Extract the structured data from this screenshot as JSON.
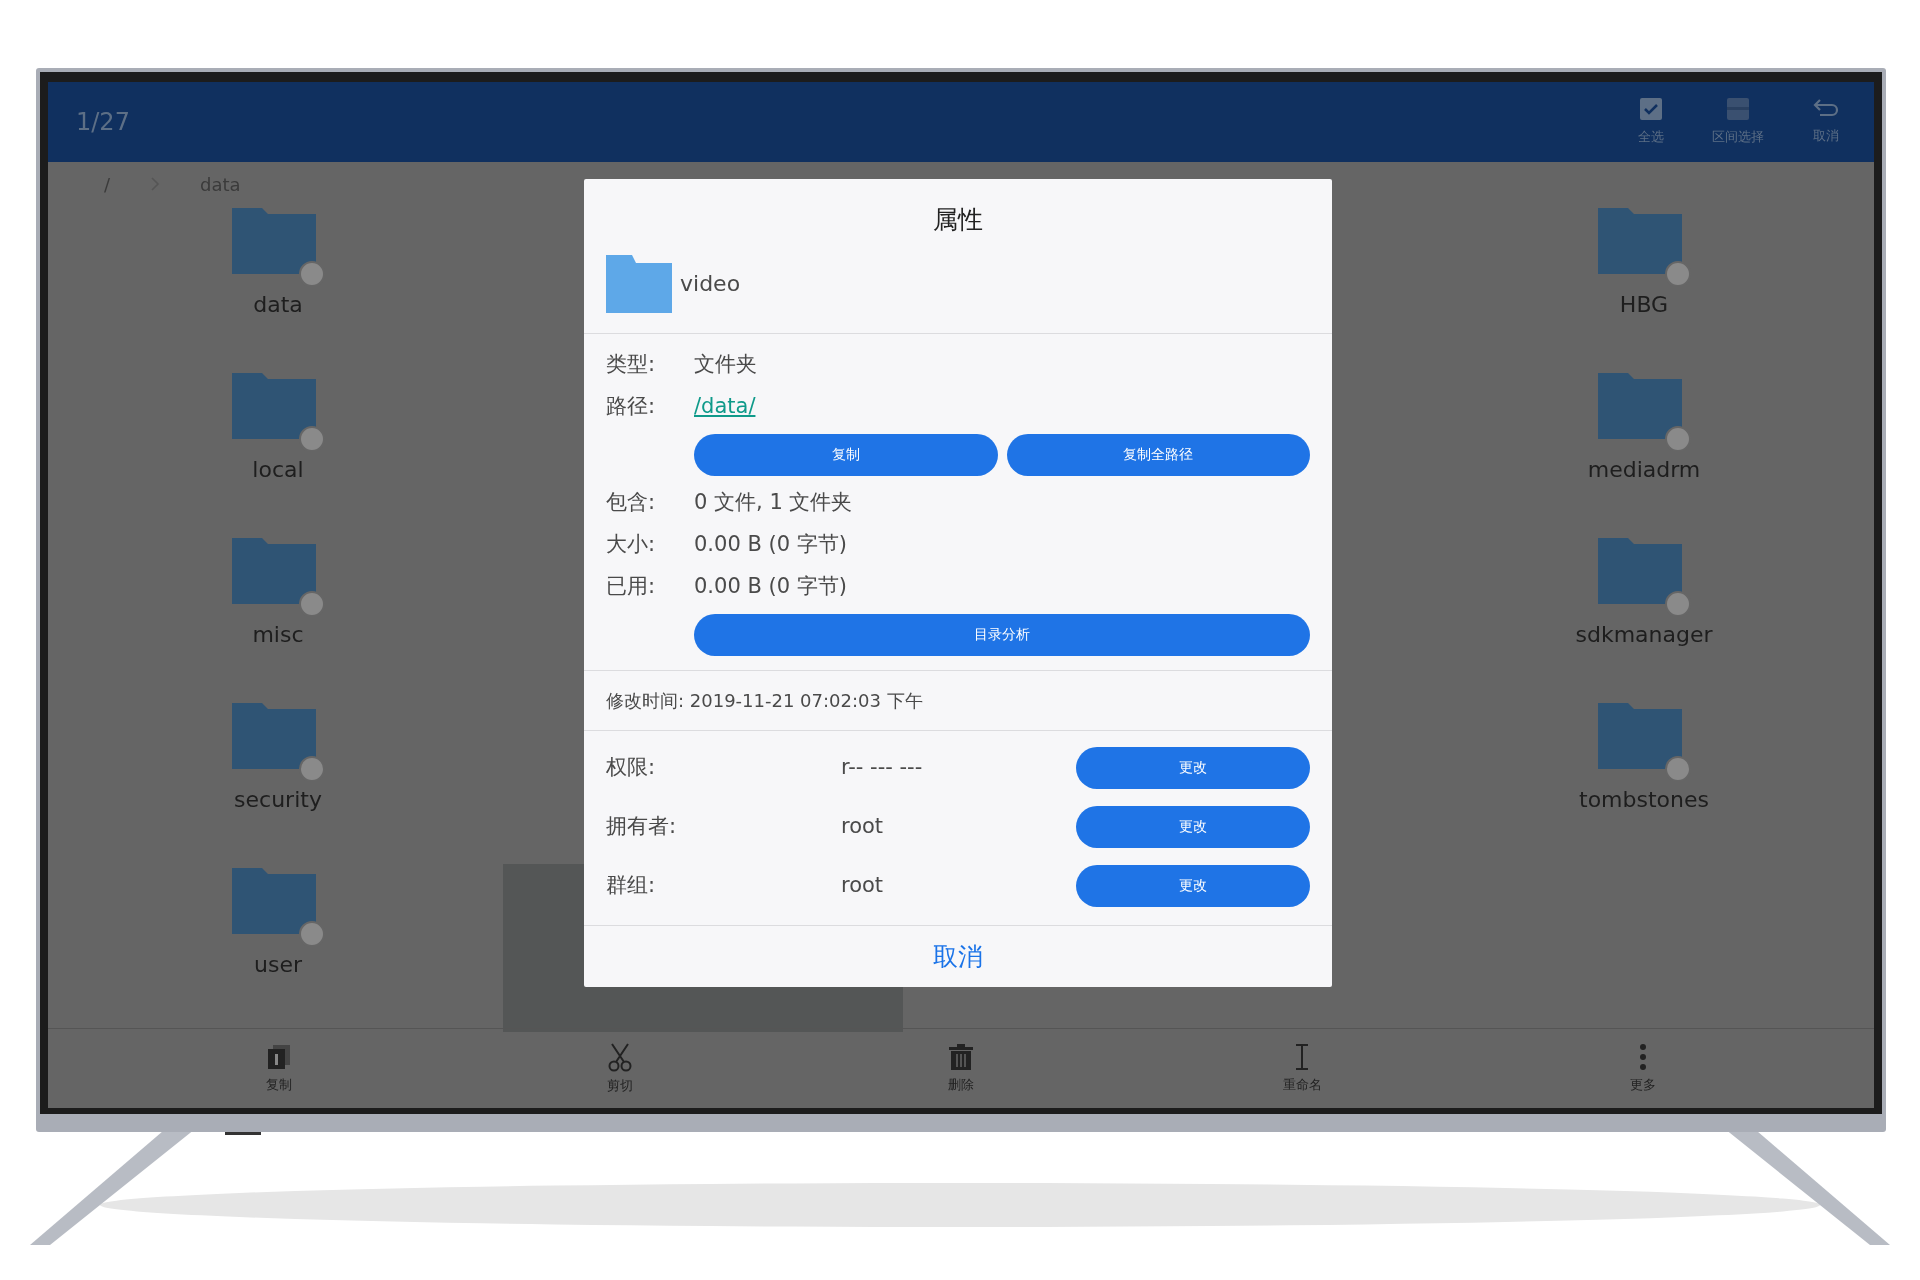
{
  "header": {
    "counter": "1/27",
    "actions": [
      {
        "kind": "check",
        "label": "全选"
      },
      {
        "kind": "range",
        "label": "区间选择"
      },
      {
        "kind": "back",
        "label": "取消"
      }
    ]
  },
  "breadcrumb": [
    "/",
    "data"
  ],
  "folders": [
    {
      "name": "data"
    },
    {
      "name": "HBG"
    },
    {
      "name": "local"
    },
    {
      "name": "mediadrm"
    },
    {
      "name": "misc"
    },
    {
      "name": "sdkmanager"
    },
    {
      "name": "security"
    },
    {
      "name": "tombstones"
    },
    {
      "name": "user"
    }
  ],
  "dialog": {
    "title": "属性",
    "file_name": "video",
    "fields": [
      {
        "kind": "text",
        "label": "类型:",
        "value": "文件夹"
      },
      {
        "kind": "link",
        "label": "路径:",
        "value": "/data/"
      },
      {
        "kind": "buttons",
        "buttons": [
          "复制",
          "复制全路径"
        ]
      },
      {
        "kind": "text",
        "label": "包含:",
        "value": "0 文件, 1 文件夹"
      },
      {
        "kind": "text",
        "label": "大小:",
        "value": "0.00 B (0 字节)"
      },
      {
        "kind": "text",
        "label": "已用:",
        "value": "0.00 B (0 字节)"
      },
      {
        "kind": "buttons",
        "buttons": [
          "目录分析"
        ]
      }
    ],
    "modified": "修改时间: 2019-11-21 07:02:03 下午",
    "ownership": [
      {
        "label": "权限:",
        "value": "r-- --- ---",
        "button": "更改"
      },
      {
        "label": "拥有者:",
        "value": "root",
        "button": "更改"
      },
      {
        "label": "群组:",
        "value": "root",
        "button": "更改"
      }
    ],
    "cancel": "取消"
  },
  "toolbar": [
    {
      "kind": "copy",
      "label": "复制"
    },
    {
      "kind": "cut",
      "label": "剪切"
    },
    {
      "kind": "delete",
      "label": "删除"
    },
    {
      "kind": "rename",
      "label": "重命名"
    },
    {
      "kind": "more",
      "label": "更多"
    }
  ]
}
